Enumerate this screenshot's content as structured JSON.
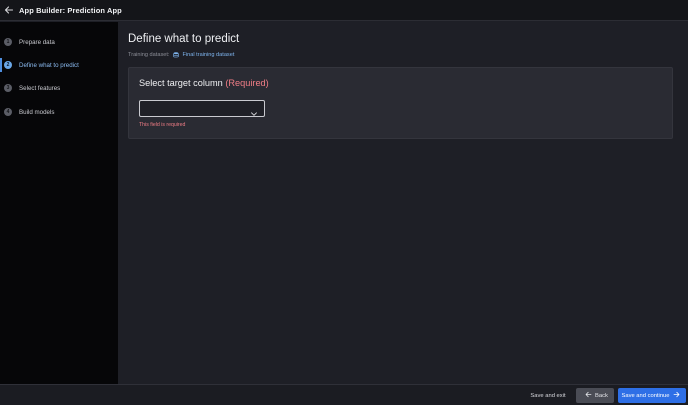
{
  "header": {
    "back_icon": "arrow-left-icon",
    "title": "App Builder: Prediction App"
  },
  "sidebar": {
    "steps": [
      {
        "number": "1",
        "label": "Prepare data",
        "active": false
      },
      {
        "number": "2",
        "label": "Define what to predict",
        "active": true
      },
      {
        "number": "3",
        "label": "Select features",
        "active": false
      },
      {
        "number": "4",
        "label": "Build models",
        "active": false
      }
    ]
  },
  "main": {
    "title": "Define what to predict",
    "dataset_label": "Training dataset:",
    "dataset_icon": "database-icon",
    "dataset_name": "Final training dataset",
    "card": {
      "title": "Select target column",
      "required": "(Required)",
      "select_value": "",
      "error": "This field is required"
    }
  },
  "footer": {
    "save_exit": "Save and exit",
    "back": "Back",
    "continue": "Save and continue"
  },
  "colors": {
    "accent": "#2e6fe6",
    "error": "#f07d86",
    "active_step": "#6aa7e8"
  }
}
